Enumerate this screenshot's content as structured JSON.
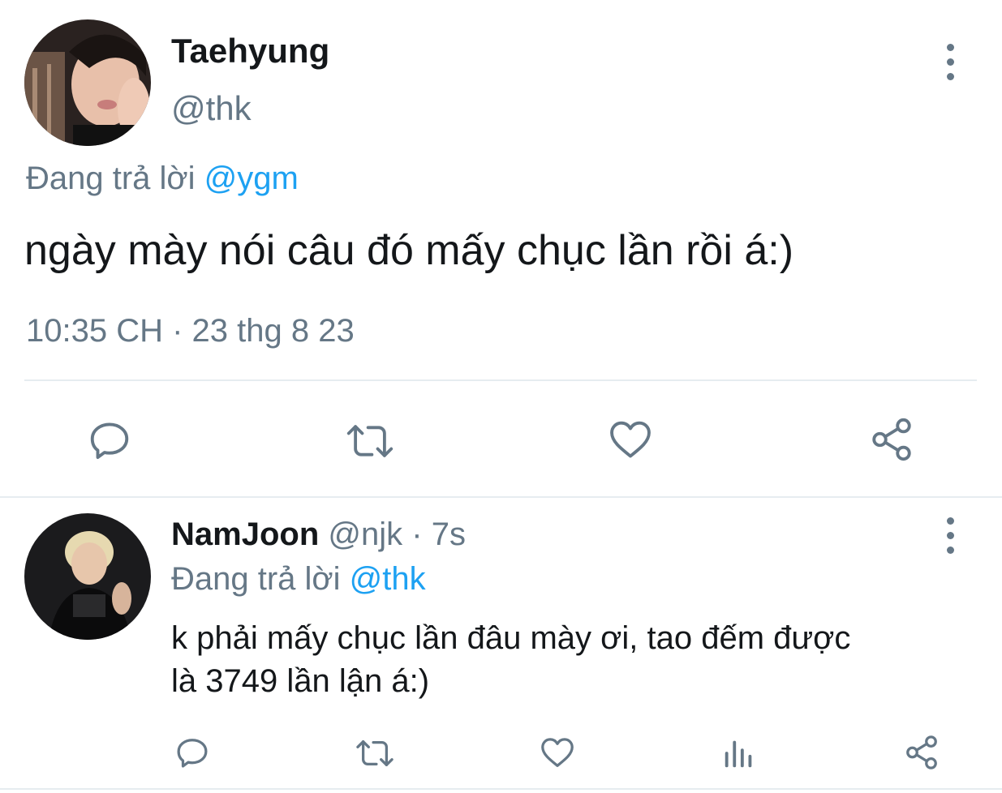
{
  "main_tweet": {
    "author_name": "Taehyung",
    "author_handle": "@thk",
    "reply_prefix": "Đang trả lời",
    "reply_to": "@ygm",
    "text": "ngày mày nói câu đó mấy chục lần rồi á:)",
    "timestamp": "10:35 CH · 23 thg 8 23",
    "actions": [
      "reply-icon",
      "retweet-icon",
      "like-icon",
      "share-icon"
    ]
  },
  "reply_tweet": {
    "author_name": "NamJoon",
    "author_handle": "@njk",
    "separator": "·",
    "time_ago": "7s",
    "reply_prefix": "Đang trả lời",
    "reply_to": "@thk",
    "text_line1": "k phải mấy chục lần đâu mày ơi, tao đếm được",
    "text_line2": "là 3749 lần lận á:)",
    "actions": [
      "reply-icon",
      "retweet-icon",
      "like-icon",
      "analytics-icon",
      "share-icon"
    ]
  },
  "colors": {
    "text": "#14171a",
    "muted": "#657786",
    "link": "#1da1f2",
    "divider": "#e6ecf0"
  }
}
